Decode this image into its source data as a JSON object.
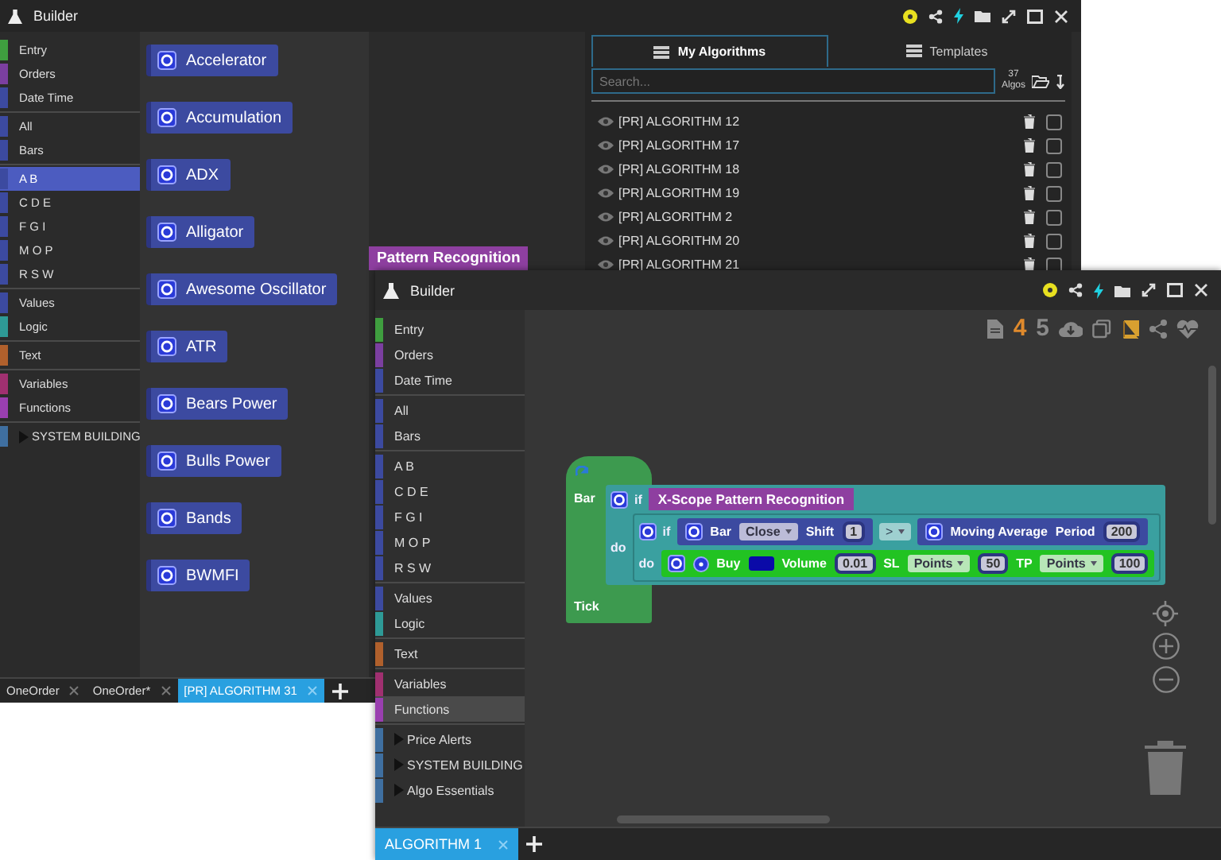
{
  "back_window": {
    "title": "Builder",
    "sidebar": [
      {
        "items": [
          {
            "label": "Entry",
            "color": "#3f9e3f",
            "selected": false,
            "kind": "category"
          },
          {
            "label": "Orders",
            "color": "#7b3fa0",
            "selected": false,
            "kind": "category"
          },
          {
            "label": "Date Time",
            "color": "#3c4aa0",
            "selected": false,
            "kind": "category"
          }
        ]
      },
      {
        "items": [
          {
            "label": "All",
            "color": "#3c4aa0",
            "selected": false,
            "kind": "category"
          },
          {
            "label": "Bars",
            "color": "#3c4aa0",
            "selected": false,
            "kind": "category"
          }
        ]
      },
      {
        "items": [
          {
            "label": "A B",
            "color": "#3c4aa0",
            "selected": true,
            "kind": "category"
          },
          {
            "label": "C D E",
            "color": "#3c4aa0",
            "selected": false,
            "kind": "category"
          },
          {
            "label": "F G I",
            "color": "#3c4aa0",
            "selected": false,
            "kind": "category"
          },
          {
            "label": "M O P",
            "color": "#3c4aa0",
            "selected": false,
            "kind": "category"
          },
          {
            "label": "R S W",
            "color": "#3c4aa0",
            "selected": false,
            "kind": "category"
          }
        ]
      },
      {
        "items": [
          {
            "label": "Values",
            "color": "#3c4aa0",
            "selected": false,
            "kind": "category"
          },
          {
            "label": "Logic",
            "color": "#2e9a96",
            "selected": false,
            "kind": "category"
          }
        ]
      },
      {
        "items": [
          {
            "label": "Text",
            "color": "#b0602c",
            "selected": false,
            "kind": "category"
          }
        ]
      },
      {
        "items": [
          {
            "label": "Variables",
            "color": "#a03070",
            "selected": false,
            "kind": "category"
          },
          {
            "label": "Functions",
            "color": "#9a3fb0",
            "selected": false,
            "kind": "category"
          }
        ]
      },
      {
        "items": [
          {
            "label": "SYSTEM BUILDING",
            "color": "#3f6fa0",
            "selected": false,
            "kind": "folder"
          }
        ]
      }
    ],
    "blocks": [
      "Accelerator",
      "Accumulation",
      "ADX",
      "Alligator",
      "Awesome Oscillator",
      "ATR",
      "Bears Power",
      "Bulls Power",
      "Bands",
      "BWMFI"
    ],
    "canvas_block": "Pattern Recognition",
    "library": {
      "tabs": [
        {
          "label": "My Algorithms",
          "selected": true
        },
        {
          "label": "Templates",
          "selected": false
        }
      ],
      "search": {
        "placeholder": "Search..."
      },
      "count": "37",
      "count_label": "Algos",
      "rows": [
        {
          "name": "[PR] ALGORITHM 12",
          "checked": false
        },
        {
          "name": "[PR] ALGORITHM 17",
          "checked": false
        },
        {
          "name": "[PR] ALGORITHM 18",
          "checked": false
        },
        {
          "name": "[PR] ALGORITHM 19",
          "checked": false
        },
        {
          "name": "[PR] ALGORITHM 2",
          "checked": false
        },
        {
          "name": "[PR] ALGORITHM 20",
          "checked": false
        },
        {
          "name": "[PR] ALGORITHM 21",
          "checked": false
        }
      ]
    },
    "tabs": [
      {
        "label": "OneOrder",
        "selected": false
      },
      {
        "label": "OneOrder*",
        "selected": false
      },
      {
        "label": "[PR] ALGORITHM 31",
        "selected": true
      }
    ]
  },
  "front_window": {
    "title": "Builder",
    "sidebar": [
      {
        "items": [
          {
            "label": "Entry",
            "color": "#3f9e3f",
            "selected": false,
            "kind": "category"
          },
          {
            "label": "Orders",
            "color": "#7b3fa0",
            "selected": false,
            "kind": "category"
          },
          {
            "label": "Date Time",
            "color": "#3c4aa0",
            "selected": false,
            "kind": "category"
          }
        ]
      },
      {
        "items": [
          {
            "label": "All",
            "color": "#3c4aa0",
            "selected": false,
            "kind": "category"
          },
          {
            "label": "Bars",
            "color": "#3c4aa0",
            "selected": false,
            "kind": "category"
          }
        ]
      },
      {
        "items": [
          {
            "label": "A B",
            "color": "#3c4aa0",
            "selected": false,
            "kind": "category"
          },
          {
            "label": "C D E",
            "color": "#3c4aa0",
            "selected": false,
            "kind": "category"
          },
          {
            "label": "F G I",
            "color": "#3c4aa0",
            "selected": false,
            "kind": "category"
          },
          {
            "label": "M O P",
            "color": "#3c4aa0",
            "selected": false,
            "kind": "category"
          },
          {
            "label": "R S W",
            "color": "#3c4aa0",
            "selected": false,
            "kind": "category"
          }
        ]
      },
      {
        "items": [
          {
            "label": "Values",
            "color": "#3c4aa0",
            "selected": false,
            "kind": "category"
          },
          {
            "label": "Logic",
            "color": "#2e9a96",
            "selected": false,
            "kind": "category"
          }
        ]
      },
      {
        "items": [
          {
            "label": "Text",
            "color": "#b0602c",
            "selected": false,
            "kind": "category"
          }
        ]
      },
      {
        "items": [
          {
            "label": "Variables",
            "color": "#a03070",
            "selected": false,
            "kind": "category"
          },
          {
            "label": "Functions",
            "color": "#9a3fb0",
            "selected": true,
            "kind": "category"
          }
        ]
      },
      {
        "items": [
          {
            "label": "Price Alerts",
            "color": "#3f6fa0",
            "selected": false,
            "kind": "folder"
          },
          {
            "label": "SYSTEM BUILDING",
            "color": "#3f6fa0",
            "selected": false,
            "kind": "folder"
          },
          {
            "label": "Algo Essentials",
            "color": "#3f6fa0",
            "selected": false,
            "kind": "folder"
          }
        ]
      }
    ],
    "toolbar_numbers": [
      {
        "text": "4",
        "color": "#e08a2c"
      },
      {
        "text": "5",
        "color": "#8a8a8a"
      }
    ],
    "program": {
      "event_labels": [
        "Bar",
        "Tick"
      ],
      "outer_if": {
        "if": "if",
        "do": "do",
        "condition": "X-Scope Pattern Recognition"
      },
      "inner_if": {
        "if": "if",
        "do": "do"
      },
      "left": {
        "name": "Bar",
        "dropdown": "Close",
        "param": "Shift",
        "value": "1"
      },
      "operator": ">",
      "right": {
        "name": "Moving Average",
        "param": "Period",
        "value": "200"
      },
      "action": {
        "name": "Buy",
        "fields": [
          {
            "kind": "value",
            "label": "Volume",
            "value": "0.01"
          },
          {
            "kind": "unit_value",
            "label": "SL",
            "unit": "Points",
            "value": "50"
          },
          {
            "kind": "unit_value",
            "label": "TP",
            "unit": "Points",
            "value": "100"
          }
        ]
      }
    },
    "tabs": [
      {
        "label": "ALGORITHM 1",
        "selected": true
      }
    ]
  }
}
